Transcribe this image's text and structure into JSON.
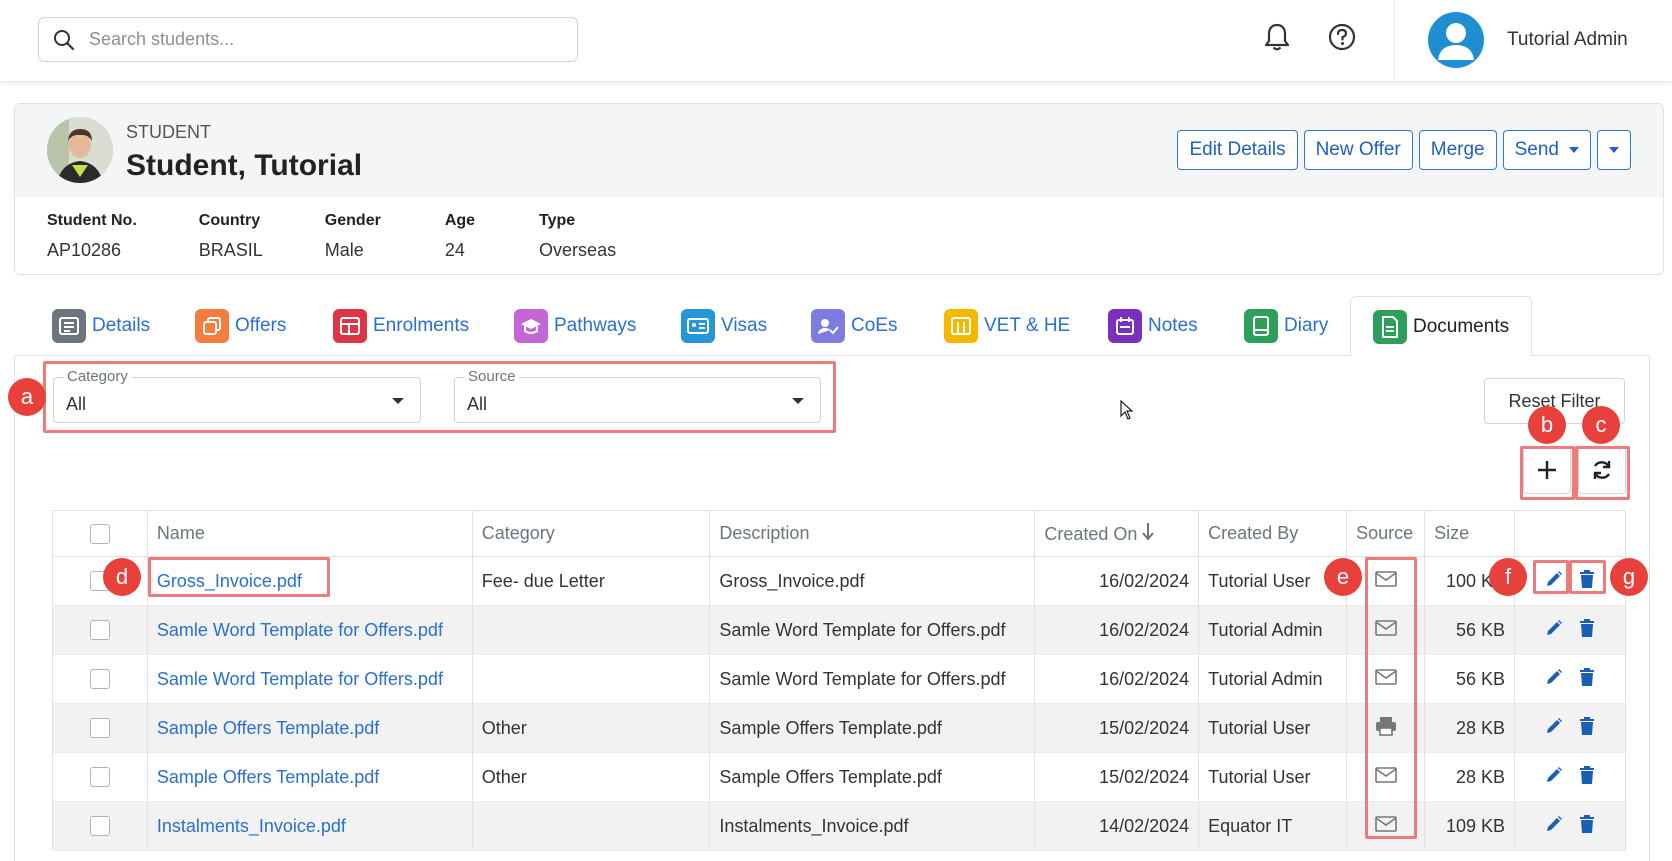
{
  "header": {
    "search_placeholder": "Search students...",
    "user_name": "Tutorial Admin"
  },
  "student": {
    "label": "STUDENT",
    "name": "Student, Tutorial",
    "buttons": {
      "edit": "Edit Details",
      "new_offer": "New Offer",
      "merge": "Merge",
      "send": "Send"
    },
    "fields": [
      {
        "key": "Student No.",
        "value": "AP10286"
      },
      {
        "key": "Country",
        "value": "BRASIL"
      },
      {
        "key": "Gender",
        "value": "Male"
      },
      {
        "key": "Age",
        "value": "24"
      },
      {
        "key": "Type",
        "value": "Overseas"
      }
    ]
  },
  "tabs": [
    {
      "label": "Details",
      "color": "#6c757d"
    },
    {
      "label": "Offers",
      "color": "#f47c3c"
    },
    {
      "label": "Enrolments",
      "color": "#dc3545"
    },
    {
      "label": "Pathways",
      "color": "#c566d6"
    },
    {
      "label": "Visas",
      "color": "#2596d8"
    },
    {
      "label": "CoEs",
      "color": "#7d7ce0"
    },
    {
      "label": "VET & HE",
      "color": "#f5b800"
    },
    {
      "label": "Notes",
      "color": "#7b2fbe"
    },
    {
      "label": "Diary",
      "color": "#2e9e5b"
    },
    {
      "label": "Documents",
      "color": "#2e9e5b"
    }
  ],
  "filters": {
    "category_label": "Category",
    "category_value": "All",
    "source_label": "Source",
    "source_value": "All",
    "reset_label": "Reset Filter"
  },
  "table": {
    "columns": [
      "Name",
      "Category",
      "Description",
      "Created On",
      "Created By",
      "Source",
      "Size"
    ],
    "rows": [
      {
        "name": "Gross_Invoice.pdf",
        "category": "Fee- due Letter",
        "description": "Gross_Invoice.pdf",
        "created_on": "16/02/2024",
        "created_by": "Tutorial User",
        "source": "envelope-icon",
        "size": "100 KB"
      },
      {
        "name": "Samle Word Template for Offers.pdf",
        "category": "",
        "description": "Samle Word Template for Offers.pdf",
        "created_on": "16/02/2024",
        "created_by": "Tutorial Admin",
        "source": "envelope-icon",
        "size": "56 KB"
      },
      {
        "name": "Samle Word Template for Offers.pdf",
        "category": "",
        "description": "Samle Word Template for Offers.pdf",
        "created_on": "16/02/2024",
        "created_by": "Tutorial Admin",
        "source": "envelope-icon",
        "size": "56 KB"
      },
      {
        "name": "Sample Offers Template.pdf",
        "category": "Other",
        "description": "Sample Offers Template.pdf",
        "created_on": "15/02/2024",
        "created_by": "Tutorial User",
        "source": "printer-icon",
        "size": "28 KB"
      },
      {
        "name": "Sample Offers Template.pdf",
        "category": "Other",
        "description": "Sample Offers Template.pdf",
        "created_on": "15/02/2024",
        "created_by": "Tutorial User",
        "source": "envelope-icon",
        "size": "28 KB"
      },
      {
        "name": "Instalments_Invoice.pdf",
        "category": "",
        "description": "Instalments_Invoice.pdf",
        "created_on": "14/02/2024",
        "created_by": "Equator IT",
        "source": "envelope-icon",
        "size": "109 KB"
      }
    ]
  },
  "annotations": {
    "a": "a",
    "b": "b",
    "c": "c",
    "d": "d",
    "e": "e",
    "f": "f",
    "g": "g"
  }
}
